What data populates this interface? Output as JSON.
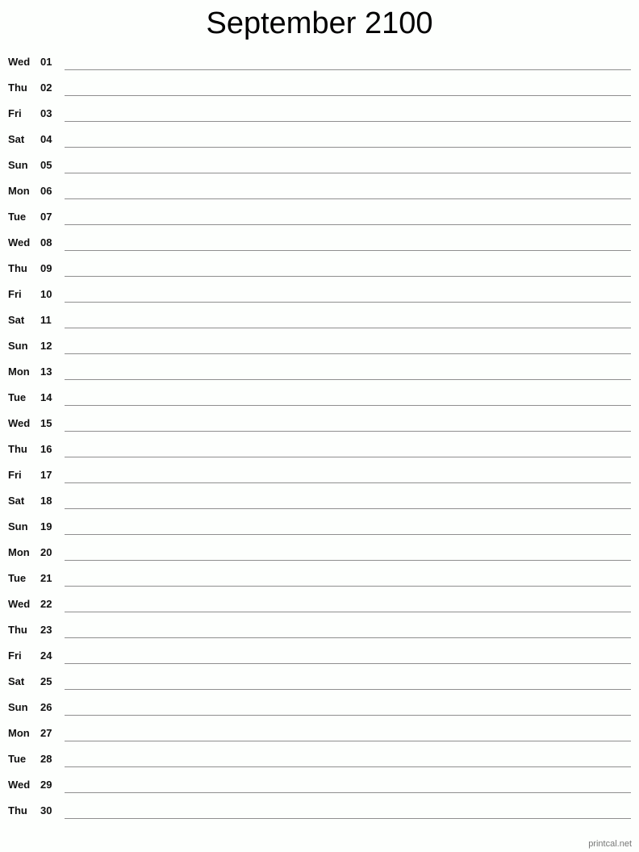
{
  "title": "September 2100",
  "days": [
    {
      "dow": "Wed",
      "num": "01"
    },
    {
      "dow": "Thu",
      "num": "02"
    },
    {
      "dow": "Fri",
      "num": "03"
    },
    {
      "dow": "Sat",
      "num": "04"
    },
    {
      "dow": "Sun",
      "num": "05"
    },
    {
      "dow": "Mon",
      "num": "06"
    },
    {
      "dow": "Tue",
      "num": "07"
    },
    {
      "dow": "Wed",
      "num": "08"
    },
    {
      "dow": "Thu",
      "num": "09"
    },
    {
      "dow": "Fri",
      "num": "10"
    },
    {
      "dow": "Sat",
      "num": "11"
    },
    {
      "dow": "Sun",
      "num": "12"
    },
    {
      "dow": "Mon",
      "num": "13"
    },
    {
      "dow": "Tue",
      "num": "14"
    },
    {
      "dow": "Wed",
      "num": "15"
    },
    {
      "dow": "Thu",
      "num": "16"
    },
    {
      "dow": "Fri",
      "num": "17"
    },
    {
      "dow": "Sat",
      "num": "18"
    },
    {
      "dow": "Sun",
      "num": "19"
    },
    {
      "dow": "Mon",
      "num": "20"
    },
    {
      "dow": "Tue",
      "num": "21"
    },
    {
      "dow": "Wed",
      "num": "22"
    },
    {
      "dow": "Thu",
      "num": "23"
    },
    {
      "dow": "Fri",
      "num": "24"
    },
    {
      "dow": "Sat",
      "num": "25"
    },
    {
      "dow": "Sun",
      "num": "26"
    },
    {
      "dow": "Mon",
      "num": "27"
    },
    {
      "dow": "Tue",
      "num": "28"
    },
    {
      "dow": "Wed",
      "num": "29"
    },
    {
      "dow": "Thu",
      "num": "30"
    }
  ],
  "footer": "printcal.net"
}
